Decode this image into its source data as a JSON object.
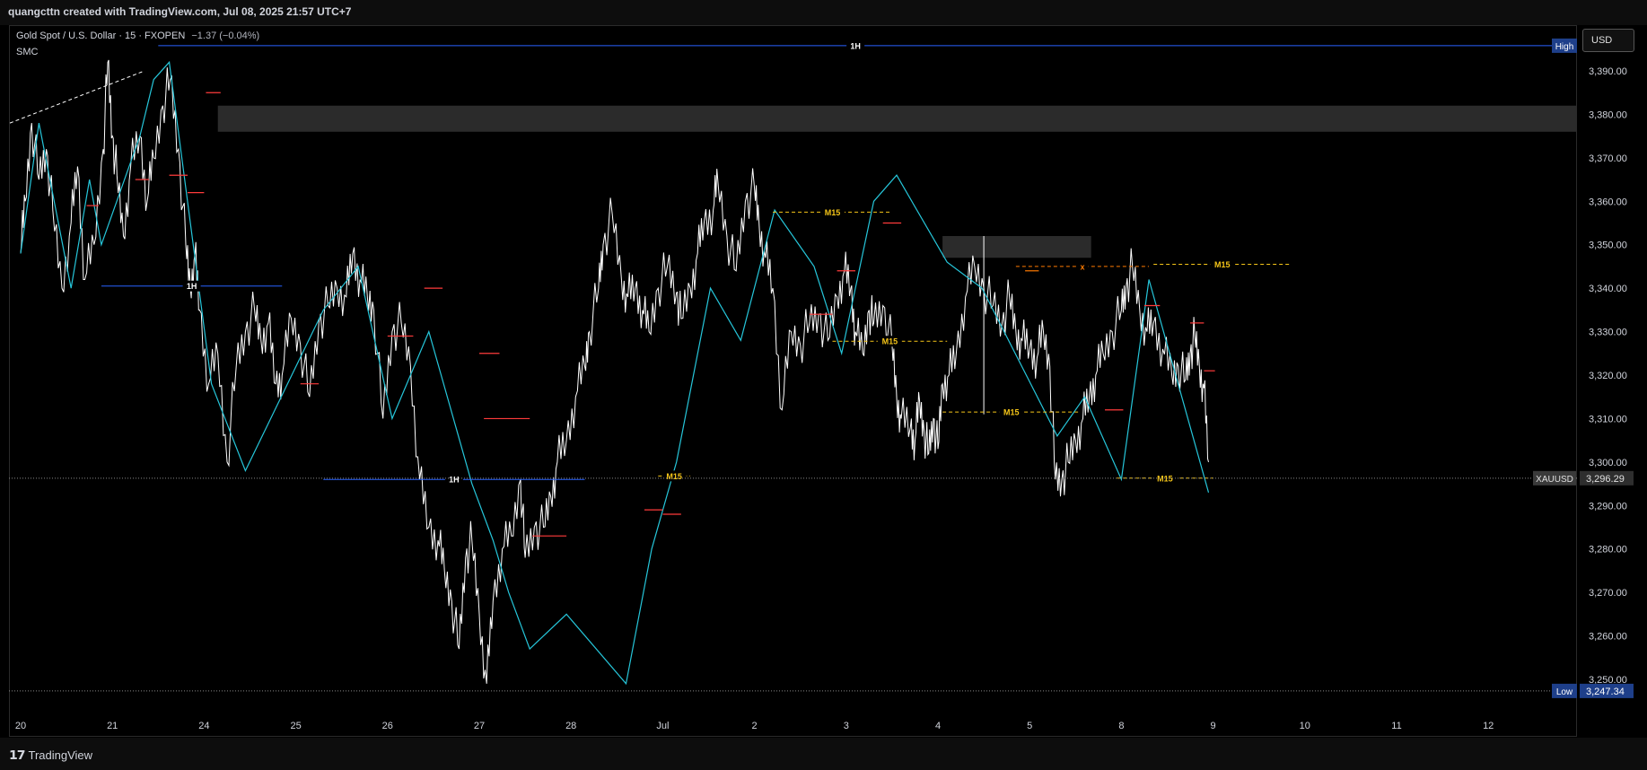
{
  "header": {
    "attribution": "quangcttn created with TradingView.com, Jul 08, 2025 21:57 UTC+7"
  },
  "legend": {
    "symbol": "Gold Spot / U.S. Dollar · 15 · FXOPEN",
    "change": "−1.37 (−0.04%)"
  },
  "indicator": {
    "name": "SMC"
  },
  "currency": {
    "label": "USD"
  },
  "footer": {
    "brand": "TradingView"
  },
  "colors": {
    "background": "#000000",
    "price": "#ffffff",
    "swing": "#26c6da",
    "level_1h": "#2962ff",
    "level_m15": "#f5c518",
    "bos": "#ff3b3b",
    "pdl": "#ff7a00"
  },
  "chart_data": {
    "type": "line",
    "symbol": "XAUUSD",
    "interval": "15",
    "last_price": "3,296.29",
    "ylim": [
      3245,
      3400
    ],
    "y_ticks": [
      3250,
      3260,
      3270,
      3280,
      3290,
      3300,
      3310,
      3320,
      3330,
      3340,
      3350,
      3360,
      3370,
      3380,
      3390
    ],
    "y_tick_labels": [
      "3,250.00",
      "3,260.00",
      "3,270.00",
      "3,280.00",
      "3,290.00",
      "3,300.00",
      "3,310.00",
      "3,320.00",
      "3,330.00",
      "3,340.00",
      "3,350.00",
      "3,360.00",
      "3,370.00",
      "3,380.00",
      "3,390.00"
    ],
    "x_ticks": [
      "20",
      "21",
      "24",
      "25",
      "26",
      "27",
      "28",
      "Jul",
      "2",
      "3",
      "4",
      "5",
      "8",
      "9",
      "10",
      "11",
      "12"
    ],
    "x_tick_index": [
      0,
      1,
      2,
      3,
      4,
      5,
      6,
      7,
      8,
      9,
      10,
      11,
      12,
      13,
      14,
      15,
      16
    ],
    "price_series": {
      "x": [
        0,
        0.05,
        0.12,
        0.2,
        0.28,
        0.35,
        0.45,
        0.55,
        0.62,
        0.7,
        0.8,
        0.9,
        0.95,
        1.0,
        1.05,
        1.12,
        1.2,
        1.3,
        1.38,
        1.45,
        1.55,
        1.63,
        1.72,
        1.8,
        1.85,
        1.9,
        1.95,
        2.05,
        2.15,
        2.25,
        2.35,
        2.45,
        2.55,
        2.62,
        2.7,
        2.78,
        2.85,
        2.95,
        3.05,
        3.15,
        3.25,
        3.35,
        3.45,
        3.55,
        3.62,
        3.7,
        3.78,
        3.85,
        3.95,
        4.05,
        4.15,
        4.25,
        4.35,
        4.45,
        4.55,
        4.62,
        4.7,
        4.78,
        4.85,
        4.92,
        5.0,
        5.08,
        5.15,
        5.25,
        5.35,
        5.45,
        5.5,
        5.6,
        5.7,
        5.78,
        5.85,
        5.95,
        6.05,
        6.15,
        6.2,
        6.3,
        6.35,
        6.45,
        6.55,
        6.62,
        6.7,
        6.78,
        6.85,
        6.95,
        7.05,
        7.15,
        7.2,
        7.3,
        7.38,
        7.45,
        7.55,
        7.6,
        7.7,
        7.8,
        7.9,
        8.0,
        8.05,
        8.12,
        8.2,
        8.3,
        8.4,
        8.5,
        8.6,
        8.7,
        8.8,
        8.9,
        8.98,
        9.05,
        9.1,
        9.18,
        9.25,
        9.3,
        9.4,
        9.5,
        9.55,
        9.6,
        9.7,
        9.75,
        9.8,
        9.85,
        9.9,
        9.95,
        10.0,
        10.05,
        10.12,
        10.2,
        10.3,
        10.4,
        10.5,
        10.6,
        10.7,
        10.78,
        10.85,
        10.92,
        11.0,
        11.08,
        11.15,
        11.22,
        11.28,
        11.35,
        11.42,
        11.5,
        11.58,
        11.65,
        11.72,
        11.8,
        11.9,
        12.0,
        12.05,
        12.12,
        12.2,
        12.28,
        12.35,
        12.45,
        12.55,
        12.62,
        12.7,
        12.75,
        12.8,
        12.85,
        12.9,
        12.95
      ],
      "y": [
        3348,
        3360,
        3378,
        3365,
        3372,
        3358,
        3340,
        3355,
        3368,
        3342,
        3350,
        3372,
        3392,
        3375,
        3366,
        3352,
        3368,
        3375,
        3360,
        3370,
        3382,
        3388,
        3372,
        3350,
        3340,
        3348,
        3335,
        3318,
        3325,
        3300,
        3322,
        3330,
        3335,
        3328,
        3332,
        3318,
        3320,
        3333,
        3327,
        3315,
        3332,
        3336,
        3340,
        3338,
        3348,
        3342,
        3338,
        3335,
        3310,
        3330,
        3332,
        3322,
        3296,
        3285,
        3282,
        3275,
        3268,
        3257,
        3278,
        3282,
        3265,
        3249,
        3268,
        3280,
        3283,
        3296,
        3278,
        3285,
        3285,
        3292,
        3300,
        3305,
        3315,
        3322,
        3330,
        3340,
        3350,
        3357,
        3342,
        3338,
        3340,
        3335,
        3330,
        3340,
        3345,
        3339,
        3333,
        3340,
        3348,
        3355,
        3358,
        3365,
        3352,
        3344,
        3360,
        3363,
        3355,
        3347,
        3340,
        3312,
        3330,
        3327,
        3332,
        3334,
        3328,
        3338,
        3344,
        3340,
        3330,
        3325,
        3335,
        3332,
        3336,
        3327,
        3315,
        3310,
        3308,
        3305,
        3314,
        3307,
        3302,
        3310,
        3303,
        3318,
        3320,
        3325,
        3338,
        3345,
        3340,
        3336,
        3332,
        3338,
        3330,
        3328,
        3326,
        3324,
        3330,
        3322,
        3296,
        3296,
        3300,
        3305,
        3310,
        3315,
        3320,
        3325,
        3330,
        3335,
        3340,
        3345,
        3335,
        3330,
        3332,
        3326,
        3320,
        3322,
        3319,
        3325,
        3329,
        3322,
        3317,
        3300,
        3293
      ]
    },
    "zigzag": {
      "x": [
        0,
        0.2,
        0.55,
        0.75,
        0.88,
        1.3,
        1.45,
        1.62,
        2.08,
        2.45,
        3.3,
        3.68,
        4.05,
        4.45,
        4.92,
        5.15,
        5.32,
        5.55,
        5.95,
        6.6,
        6.88,
        7.15,
        7.52,
        7.85,
        8.22,
        8.65,
        8.95,
        9.3,
        9.55,
        10.1,
        10.48,
        11.3,
        11.6,
        12.0,
        12.3,
        12.95
      ],
      "y": [
        3348,
        3378,
        3340,
        3365,
        3350,
        3375,
        3388,
        3392,
        3318,
        3298,
        3335,
        3345,
        3310,
        3330,
        3295,
        3282,
        3270,
        3257,
        3265,
        3249,
        3280,
        3300,
        3340,
        3328,
        3358,
        3345,
        3325,
        3360,
        3366,
        3346,
        3340,
        3306,
        3315,
        3296,
        3342,
        3293
      ]
    },
    "zones": [
      {
        "name": "1H supply zone",
        "x": [
          2.15,
          17
        ],
        "y": [
          3376,
          3382
        ]
      },
      {
        "name": "M15 supply zone",
        "x": [
          10.05,
          11.67
        ],
        "y": [
          3347,
          3352
        ]
      }
    ],
    "levels": [
      {
        "label": "1H",
        "style": "blue-solid",
        "x": [
          1.5,
          17.2
        ],
        "y": 3395.8
      },
      {
        "label": "1H",
        "style": "blue-solid",
        "x": [
          0.88,
          2.85
        ],
        "y": 3340.5
      },
      {
        "label": "1H",
        "style": "blue-solid",
        "x": [
          3.3,
          6.15
        ],
        "y": 3296
      },
      {
        "label": "M15",
        "style": "yellow-dashed",
        "x": [
          8.2,
          9.5
        ],
        "y": 3357.5
      },
      {
        "label": "M15",
        "style": "yellow-dashed",
        "x": [
          8.85,
          10.1
        ],
        "y": 3327.8
      },
      {
        "label": "M15",
        "style": "yellow-dashed",
        "x": [
          10.05,
          11.55
        ],
        "y": 3311.5
      },
      {
        "label": "M15",
        "style": "yellow-dashed",
        "x": [
          6.95,
          7.3
        ],
        "y": 3296.8
      },
      {
        "label": "M15",
        "style": "yellow-dashed",
        "x": [
          11.95,
          13.0
        ],
        "y": 3296.3
      },
      {
        "label": "M15",
        "style": "yellow-dashed",
        "x": [
          12.35,
          13.85
        ],
        "y": 3345.5
      },
      {
        "label": "x",
        "style": "orange-dashed",
        "x": [
          10.85,
          12.3
        ],
        "y": 3345
      }
    ],
    "bos_marks": [
      {
        "x": [
          0.72,
          0.85
        ],
        "y": 3359
      },
      {
        "x": [
          1.25,
          1.4
        ],
        "y": 3365
      },
      {
        "x": [
          1.62,
          1.82
        ],
        "y": 3366
      },
      {
        "x": [
          1.82,
          2.0
        ],
        "y": 3362
      },
      {
        "x": [
          2.02,
          2.18
        ],
        "y": 3385
      },
      {
        "x": [
          3.05,
          3.25
        ],
        "y": 3318
      },
      {
        "x": [
          4.0,
          4.28
        ],
        "y": 3329
      },
      {
        "x": [
          4.4,
          4.6
        ],
        "y": 3340
      },
      {
        "x": [
          5.0,
          5.22
        ],
        "y": 3325
      },
      {
        "x": [
          5.05,
          5.55
        ],
        "y": 3310
      },
      {
        "x": [
          5.58,
          5.95
        ],
        "y": 3283
      },
      {
        "x": [
          6.8,
          7.0
        ],
        "y": 3289
      },
      {
        "x": [
          7.0,
          7.2
        ],
        "y": 3288
      },
      {
        "x": [
          8.6,
          8.85
        ],
        "y": 3334
      },
      {
        "x": [
          8.9,
          9.1
        ],
        "y": 3344
      },
      {
        "x": [
          9.4,
          9.6
        ],
        "y": 3355
      },
      {
        "x": [
          11.82,
          12.02
        ],
        "y": 3312
      },
      {
        "x": [
          12.25,
          12.42
        ],
        "y": 3336
      },
      {
        "x": [
          12.75,
          12.9
        ],
        "y": 3332
      },
      {
        "x": [
          12.9,
          13.02
        ],
        "y": 3321
      }
    ],
    "pdl": [
      {
        "x": [
          10.95,
          11.1
        ],
        "y": 3344
      }
    ],
    "price_label": {
      "name": "XAUUSD",
      "value": "3,296.29",
      "y": 3296.29
    },
    "high_label": {
      "name": "High",
      "y": 3395.8
    },
    "low_label": {
      "name": "Low",
      "value": "3,247.34",
      "y": 3247.34
    },
    "diagonal_dashed": {
      "x": [
        0,
        1.35
      ],
      "y": [
        3378,
        3390
      ]
    },
    "vertical_segment": {
      "x": 10.5,
      "y": [
        3311,
        3352
      ]
    },
    "grid": false
  }
}
